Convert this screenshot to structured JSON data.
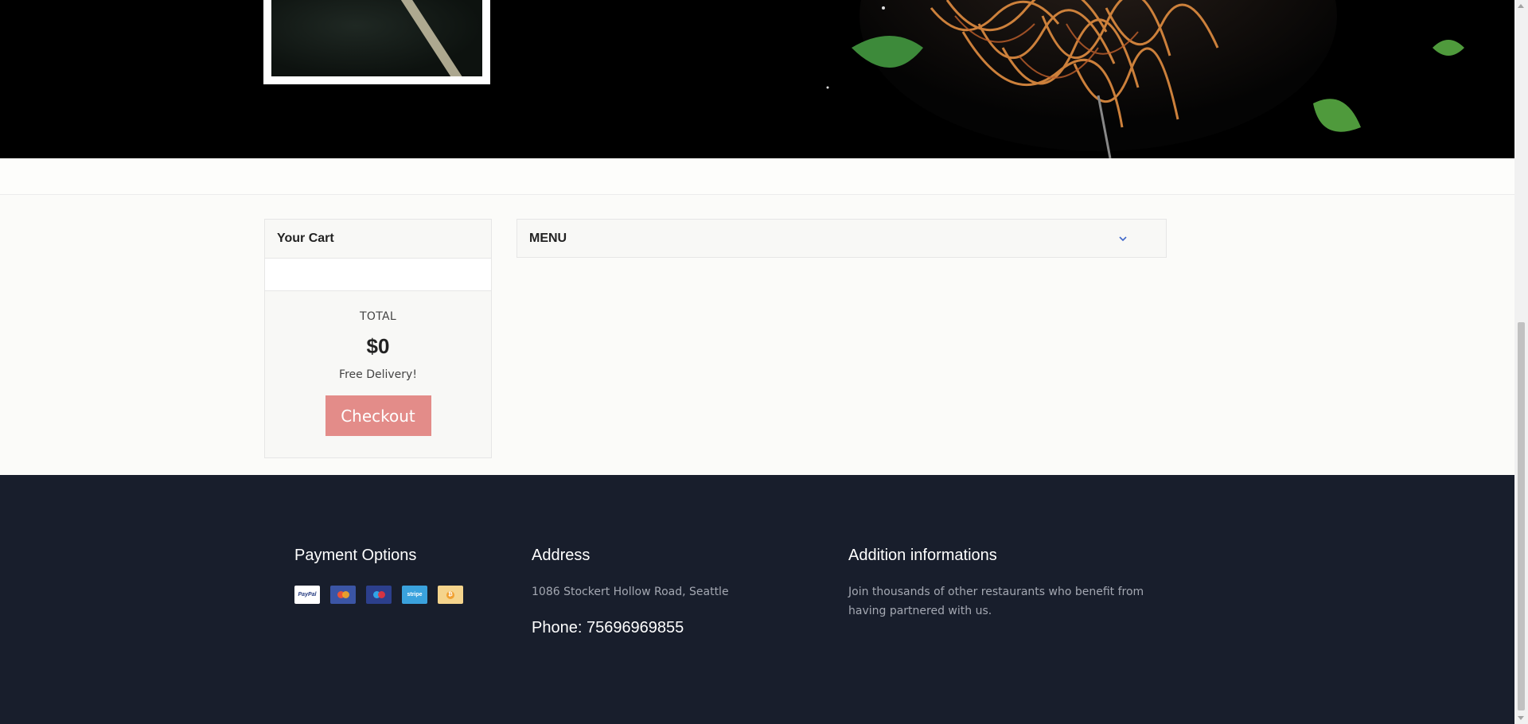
{
  "cart": {
    "title": "Your Cart",
    "total_label": "TOTAL",
    "total_value": "$0",
    "delivery_note": "Free Delivery!",
    "checkout_label": "Checkout"
  },
  "menu": {
    "label": "MENU",
    "icon": "chevron-down-icon"
  },
  "footer": {
    "payment": {
      "title": "Payment Options",
      "methods": [
        {
          "name": "paypal-icon",
          "label": "PayPal"
        },
        {
          "name": "mastercard-icon",
          "label": ""
        },
        {
          "name": "maestro-icon",
          "label": ""
        },
        {
          "name": "stripe-icon",
          "label": "stripe"
        },
        {
          "name": "bitcoin-icon",
          "label": ""
        }
      ]
    },
    "address": {
      "title": "Address",
      "text": "1086 Stockert Hollow Road, Seattle",
      "phone": "Phone: 75696969855"
    },
    "info": {
      "title": "Addition informations",
      "text": "Join thousands of other restaurants who benefit from having partnered with us."
    }
  },
  "colors": {
    "accent": "#e38c89",
    "footer_bg": "#181e2c",
    "page_bg": "#fbfbf9",
    "menu_chevron": "#3f67c9"
  }
}
